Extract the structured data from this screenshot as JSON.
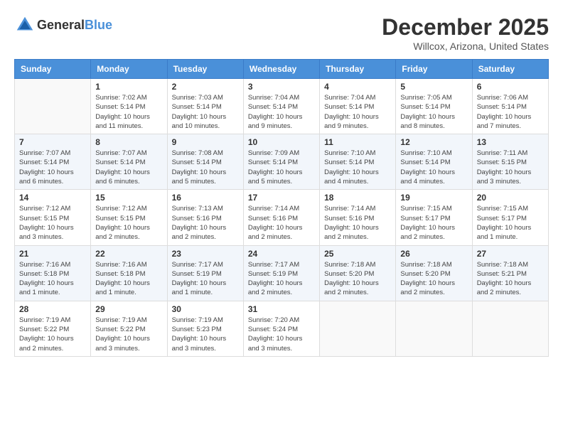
{
  "header": {
    "logo_general": "General",
    "logo_blue": "Blue",
    "month": "December 2025",
    "location": "Willcox, Arizona, United States"
  },
  "days_of_week": [
    "Sunday",
    "Monday",
    "Tuesday",
    "Wednesday",
    "Thursday",
    "Friday",
    "Saturday"
  ],
  "weeks": [
    {
      "shaded": false,
      "days": [
        {
          "num": "",
          "info": ""
        },
        {
          "num": "1",
          "info": "Sunrise: 7:02 AM\nSunset: 5:14 PM\nDaylight: 10 hours\nand 11 minutes."
        },
        {
          "num": "2",
          "info": "Sunrise: 7:03 AM\nSunset: 5:14 PM\nDaylight: 10 hours\nand 10 minutes."
        },
        {
          "num": "3",
          "info": "Sunrise: 7:04 AM\nSunset: 5:14 PM\nDaylight: 10 hours\nand 9 minutes."
        },
        {
          "num": "4",
          "info": "Sunrise: 7:04 AM\nSunset: 5:14 PM\nDaylight: 10 hours\nand 9 minutes."
        },
        {
          "num": "5",
          "info": "Sunrise: 7:05 AM\nSunset: 5:14 PM\nDaylight: 10 hours\nand 8 minutes."
        },
        {
          "num": "6",
          "info": "Sunrise: 7:06 AM\nSunset: 5:14 PM\nDaylight: 10 hours\nand 7 minutes."
        }
      ]
    },
    {
      "shaded": true,
      "days": [
        {
          "num": "7",
          "info": "Sunrise: 7:07 AM\nSunset: 5:14 PM\nDaylight: 10 hours\nand 6 minutes."
        },
        {
          "num": "8",
          "info": "Sunrise: 7:07 AM\nSunset: 5:14 PM\nDaylight: 10 hours\nand 6 minutes."
        },
        {
          "num": "9",
          "info": "Sunrise: 7:08 AM\nSunset: 5:14 PM\nDaylight: 10 hours\nand 5 minutes."
        },
        {
          "num": "10",
          "info": "Sunrise: 7:09 AM\nSunset: 5:14 PM\nDaylight: 10 hours\nand 5 minutes."
        },
        {
          "num": "11",
          "info": "Sunrise: 7:10 AM\nSunset: 5:14 PM\nDaylight: 10 hours\nand 4 minutes."
        },
        {
          "num": "12",
          "info": "Sunrise: 7:10 AM\nSunset: 5:14 PM\nDaylight: 10 hours\nand 4 minutes."
        },
        {
          "num": "13",
          "info": "Sunrise: 7:11 AM\nSunset: 5:15 PM\nDaylight: 10 hours\nand 3 minutes."
        }
      ]
    },
    {
      "shaded": false,
      "days": [
        {
          "num": "14",
          "info": "Sunrise: 7:12 AM\nSunset: 5:15 PM\nDaylight: 10 hours\nand 3 minutes."
        },
        {
          "num": "15",
          "info": "Sunrise: 7:12 AM\nSunset: 5:15 PM\nDaylight: 10 hours\nand 2 minutes."
        },
        {
          "num": "16",
          "info": "Sunrise: 7:13 AM\nSunset: 5:16 PM\nDaylight: 10 hours\nand 2 minutes."
        },
        {
          "num": "17",
          "info": "Sunrise: 7:14 AM\nSunset: 5:16 PM\nDaylight: 10 hours\nand 2 minutes."
        },
        {
          "num": "18",
          "info": "Sunrise: 7:14 AM\nSunset: 5:16 PM\nDaylight: 10 hours\nand 2 minutes."
        },
        {
          "num": "19",
          "info": "Sunrise: 7:15 AM\nSunset: 5:17 PM\nDaylight: 10 hours\nand 2 minutes."
        },
        {
          "num": "20",
          "info": "Sunrise: 7:15 AM\nSunset: 5:17 PM\nDaylight: 10 hours\nand 1 minute."
        }
      ]
    },
    {
      "shaded": true,
      "days": [
        {
          "num": "21",
          "info": "Sunrise: 7:16 AM\nSunset: 5:18 PM\nDaylight: 10 hours\nand 1 minute."
        },
        {
          "num": "22",
          "info": "Sunrise: 7:16 AM\nSunset: 5:18 PM\nDaylight: 10 hours\nand 1 minute."
        },
        {
          "num": "23",
          "info": "Sunrise: 7:17 AM\nSunset: 5:19 PM\nDaylight: 10 hours\nand 1 minute."
        },
        {
          "num": "24",
          "info": "Sunrise: 7:17 AM\nSunset: 5:19 PM\nDaylight: 10 hours\nand 2 minutes."
        },
        {
          "num": "25",
          "info": "Sunrise: 7:18 AM\nSunset: 5:20 PM\nDaylight: 10 hours\nand 2 minutes."
        },
        {
          "num": "26",
          "info": "Sunrise: 7:18 AM\nSunset: 5:20 PM\nDaylight: 10 hours\nand 2 minutes."
        },
        {
          "num": "27",
          "info": "Sunrise: 7:18 AM\nSunset: 5:21 PM\nDaylight: 10 hours\nand 2 minutes."
        }
      ]
    },
    {
      "shaded": false,
      "days": [
        {
          "num": "28",
          "info": "Sunrise: 7:19 AM\nSunset: 5:22 PM\nDaylight: 10 hours\nand 2 minutes."
        },
        {
          "num": "29",
          "info": "Sunrise: 7:19 AM\nSunset: 5:22 PM\nDaylight: 10 hours\nand 3 minutes."
        },
        {
          "num": "30",
          "info": "Sunrise: 7:19 AM\nSunset: 5:23 PM\nDaylight: 10 hours\nand 3 minutes."
        },
        {
          "num": "31",
          "info": "Sunrise: 7:20 AM\nSunset: 5:24 PM\nDaylight: 10 hours\nand 3 minutes."
        },
        {
          "num": "",
          "info": ""
        },
        {
          "num": "",
          "info": ""
        },
        {
          "num": "",
          "info": ""
        }
      ]
    }
  ]
}
